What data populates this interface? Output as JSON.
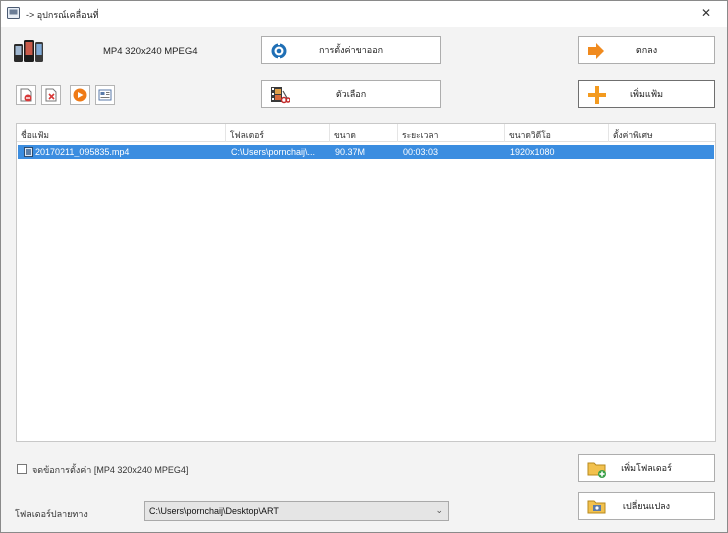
{
  "window": {
    "title": "-> อุปกรณ์เคลื่อนที่",
    "close_glyph": "✕",
    "icons": [
      "app-icon",
      "close-icon",
      "mobile-device-icon"
    ]
  },
  "header": {
    "format": "MP4 320x240 MPEG4"
  },
  "buttons": {
    "output_settings": "การตั้งค่าขาออก",
    "options": "ตัวเลือก",
    "ok": "ตกลง",
    "add_file": "เพิ่มแฟ้ม",
    "add_folder": "เพิ่มโฟลเดอร์",
    "convert": "เปลี่ยนแปลง"
  },
  "toolbar": {
    "tools": [
      "remove-file-icon",
      "clear-list-icon",
      "play-icon",
      "media-info-icon"
    ]
  },
  "table": {
    "columns": [
      "ชื่อแฟ้ม",
      "โฟลเดอร์",
      "ขนาด",
      "ระยะเวลา",
      "ขนาดวิดีโอ",
      "ตั้งค่าพิเศษ"
    ],
    "rows": [
      {
        "name": "20170211_095835.mp4",
        "folder": "C:\\Users\\pornchaij\\...",
        "size": "90.37M",
        "duration": "00:03:03",
        "video_size": "1920x1080",
        "special": ""
      }
    ]
  },
  "footer": {
    "save_setting_label": "จดข้อการตั้งค่า [MP4 320x240 MPEG4]",
    "save_setting_checked": false,
    "dest_label": "โฟลเดอร์ปลายทาง",
    "dest_value": "C:\\Users\\pornchaij\\Desktop\\ART",
    "dest_chevron": "⌄"
  },
  "colors": {
    "selection": "#3b8de0",
    "ok_arrow": "#f08a1e",
    "add_plus": "#f39a1f",
    "gear_blue": "#1f6fb5"
  }
}
